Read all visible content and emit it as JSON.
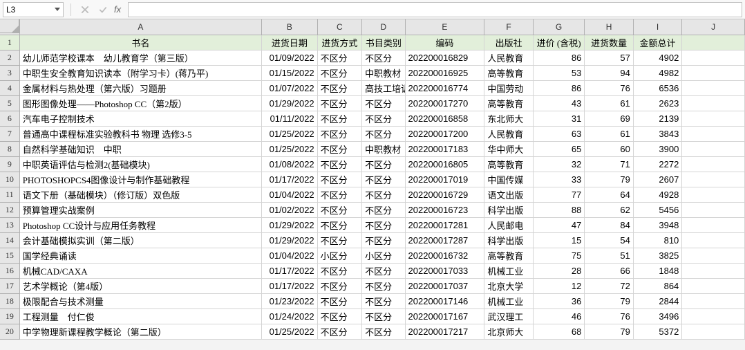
{
  "namebox": {
    "value": "L3"
  },
  "formula_bar": {
    "fx_label": "fx",
    "value": ""
  },
  "columns": [
    "A",
    "B",
    "C",
    "D",
    "E",
    "F",
    "G",
    "H",
    "I",
    "J"
  ],
  "col_widths": [
    "col-A",
    "col-B",
    "col-C",
    "col-D",
    "col-E",
    "col-F",
    "col-G",
    "col-H",
    "col-I",
    "col-J"
  ],
  "header": {
    "book_name": "书名",
    "purchase_date": "进货日期",
    "purchase_method": "进货方式",
    "book_category": "书目类别",
    "code": "编码",
    "publisher": "出版社",
    "price": "进价 (含税)",
    "qty": "进货数量",
    "amount": "金额总计"
  },
  "rows": [
    {
      "name": "幼儿师范学校课本　幼儿教育学（第三版）",
      "date": "01/09/2022",
      "method": "不区分",
      "cat": "不区分",
      "code": "202200016829",
      "pub": "人民教育",
      "price": 86,
      "qty": 57,
      "amt": 4902
    },
    {
      "name": "中职生安全教育知识读本（附学习卡）(蒋乃平)",
      "date": "01/15/2022",
      "method": "不区分",
      "cat": "中职教材",
      "code": "202200016925",
      "pub": "高等教育",
      "price": 53,
      "qty": 94,
      "amt": 4982
    },
    {
      "name": "金属材料与热处理（第六版）习题册",
      "date": "01/07/2022",
      "method": "不区分",
      "cat": "高技工培训",
      "code": "202200016774",
      "pub": "中国劳动",
      "price": 86,
      "qty": 76,
      "amt": 6536
    },
    {
      "name": "图形图像处理——Photoshop CC（第2版）",
      "date": "01/29/2022",
      "method": "不区分",
      "cat": "不区分",
      "code": "202200017270",
      "pub": "高等教育",
      "price": 43,
      "qty": 61,
      "amt": 2623
    },
    {
      "name": "汽车电子控制技术",
      "date": "01/11/2022",
      "method": "不区分",
      "cat": "不区分",
      "code": "202200016858",
      "pub": "东北师大",
      "price": 31,
      "qty": 69,
      "amt": 2139
    },
    {
      "name": "普通高中课程标准实验教科书 物理 选修3-5",
      "date": "01/25/2022",
      "method": "不区分",
      "cat": "不区分",
      "code": "202200017200",
      "pub": "人民教育",
      "price": 63,
      "qty": 61,
      "amt": 3843
    },
    {
      "name": "自然科学基础知识　中职",
      "date": "01/25/2022",
      "method": "不区分",
      "cat": "中职教材",
      "code": "202200017183",
      "pub": "华中师大",
      "price": 65,
      "qty": 60,
      "amt": 3900
    },
    {
      "name": "中职英语评估与检测2(基础模块)",
      "date": "01/08/2022",
      "method": "不区分",
      "cat": "不区分",
      "code": "202200016805",
      "pub": "高等教育",
      "price": 32,
      "qty": 71,
      "amt": 2272
    },
    {
      "name": "PHOTOSHOPCS4图像设计与制作基础教程",
      "date": "01/17/2022",
      "method": "不区分",
      "cat": "不区分",
      "code": "202200017019",
      "pub": "中国传媒",
      "price": 33,
      "qty": 79,
      "amt": 2607
    },
    {
      "name": "语文下册（基础模块）（修订版）双色版",
      "date": "01/04/2022",
      "method": "不区分",
      "cat": "不区分",
      "code": "202200016729",
      "pub": "语文出版",
      "price": 77,
      "qty": 64,
      "amt": 4928
    },
    {
      "name": "预算管理实战案例",
      "date": "01/02/2022",
      "method": "不区分",
      "cat": "不区分",
      "code": "202200016723",
      "pub": "科学出版",
      "price": 88,
      "qty": 62,
      "amt": 5456
    },
    {
      "name": "Photoshop CC设计与应用任务教程",
      "date": "01/29/2022",
      "method": "不区分",
      "cat": "不区分",
      "code": "202200017281",
      "pub": "人民邮电",
      "price": 47,
      "qty": 84,
      "amt": 3948
    },
    {
      "name": "会计基础模拟实训（第二版）",
      "date": "01/29/2022",
      "method": "不区分",
      "cat": "不区分",
      "code": "202200017287",
      "pub": "科学出版",
      "price": 15,
      "qty": 54,
      "amt": 810
    },
    {
      "name": "国学经典诵读",
      "date": "01/04/2022",
      "method": "小区分",
      "cat": "小区分",
      "code": "202200016732",
      "pub": "高等教育",
      "price": 75,
      "qty": 51,
      "amt": 3825
    },
    {
      "name": "机械CAD/CAXA",
      "date": "01/17/2022",
      "method": "不区分",
      "cat": "不区分",
      "code": "202200017033",
      "pub": "机械工业",
      "price": 28,
      "qty": 66,
      "amt": 1848
    },
    {
      "name": "艺术学概论（第4版）",
      "date": "01/17/2022",
      "method": "不区分",
      "cat": "不区分",
      "code": "202200017037",
      "pub": "北京大学",
      "price": 12,
      "qty": 72,
      "amt": 864
    },
    {
      "name": "极限配合与技术测量",
      "date": "01/23/2022",
      "method": "不区分",
      "cat": "不区分",
      "code": "202200017146",
      "pub": "机械工业",
      "price": 36,
      "qty": 79,
      "amt": 2844
    },
    {
      "name": "工程测量　付仁俊",
      "date": "01/24/2022",
      "method": "不区分",
      "cat": "不区分",
      "code": "202200017167",
      "pub": "武汉理工",
      "price": 46,
      "qty": 76,
      "amt": 3496
    },
    {
      "name": "中学物理新课程教学概论（第二版）",
      "date": "01/25/2022",
      "method": "不区分",
      "cat": "不区分",
      "code": "202200017217",
      "pub": "北京师大",
      "price": 68,
      "qty": 79,
      "amt": 5372
    }
  ]
}
